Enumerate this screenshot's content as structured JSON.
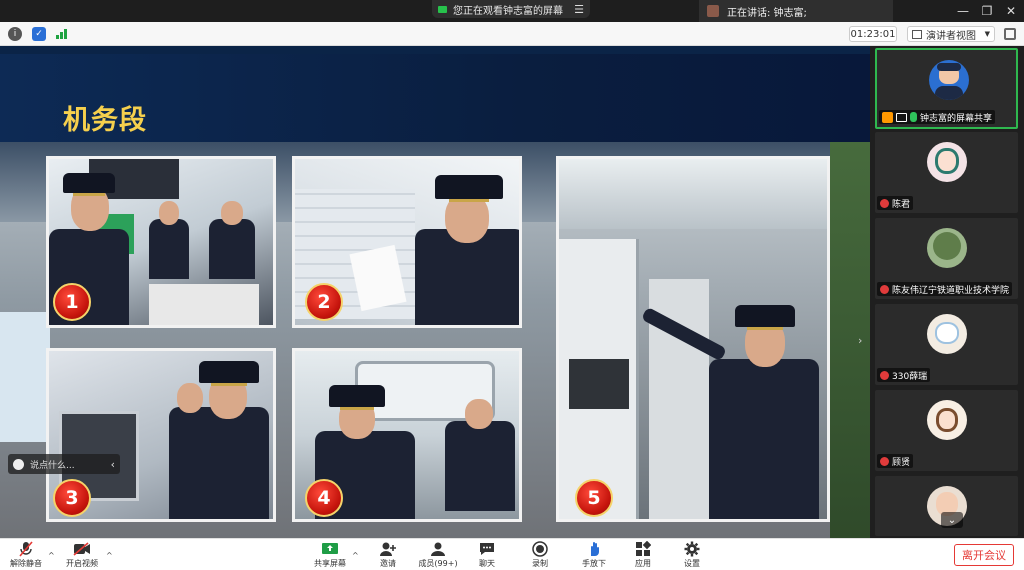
{
  "topbar": {
    "viewing_notice": "您正在观看钟志富的屏幕",
    "speaking_label": "正在讲话: 钟志富;",
    "window_controls": [
      "—",
      "❐",
      "✕"
    ]
  },
  "infobar": {
    "meeting_timer": "01:23:01",
    "view_mode": "演讲者视图"
  },
  "slide": {
    "title": "机务段",
    "step_numbers": [
      "1",
      "2",
      "3",
      "4",
      "5"
    ]
  },
  "chat": {
    "placeholder": "说点什么..."
  },
  "participants": [
    {
      "name": "钟志富的屏幕共享",
      "status": "mic-on",
      "presenter": true
    },
    {
      "name": "陈君",
      "status": "mic-off"
    },
    {
      "name": "陈友伟辽宁铁道职业技术学院",
      "status": "mic-off"
    },
    {
      "name": "330薛瑞",
      "status": "mic-off"
    },
    {
      "name": "顾贤",
      "status": "mic-off"
    }
  ],
  "toolbar": {
    "mute": "解除静音",
    "video": "开启视频",
    "share": "共享屏幕",
    "invite": "邀请",
    "members": "成员(99+)",
    "chat": "聊天",
    "record": "录制",
    "hand": "手放下",
    "apps": "应用",
    "settings": "设置",
    "leave": "离开会议"
  },
  "colors": {
    "accent_green": "#2fb84f",
    "leave_red": "#e53935",
    "slide_title": "#f6d04d",
    "badge_red": "#c5140c"
  }
}
